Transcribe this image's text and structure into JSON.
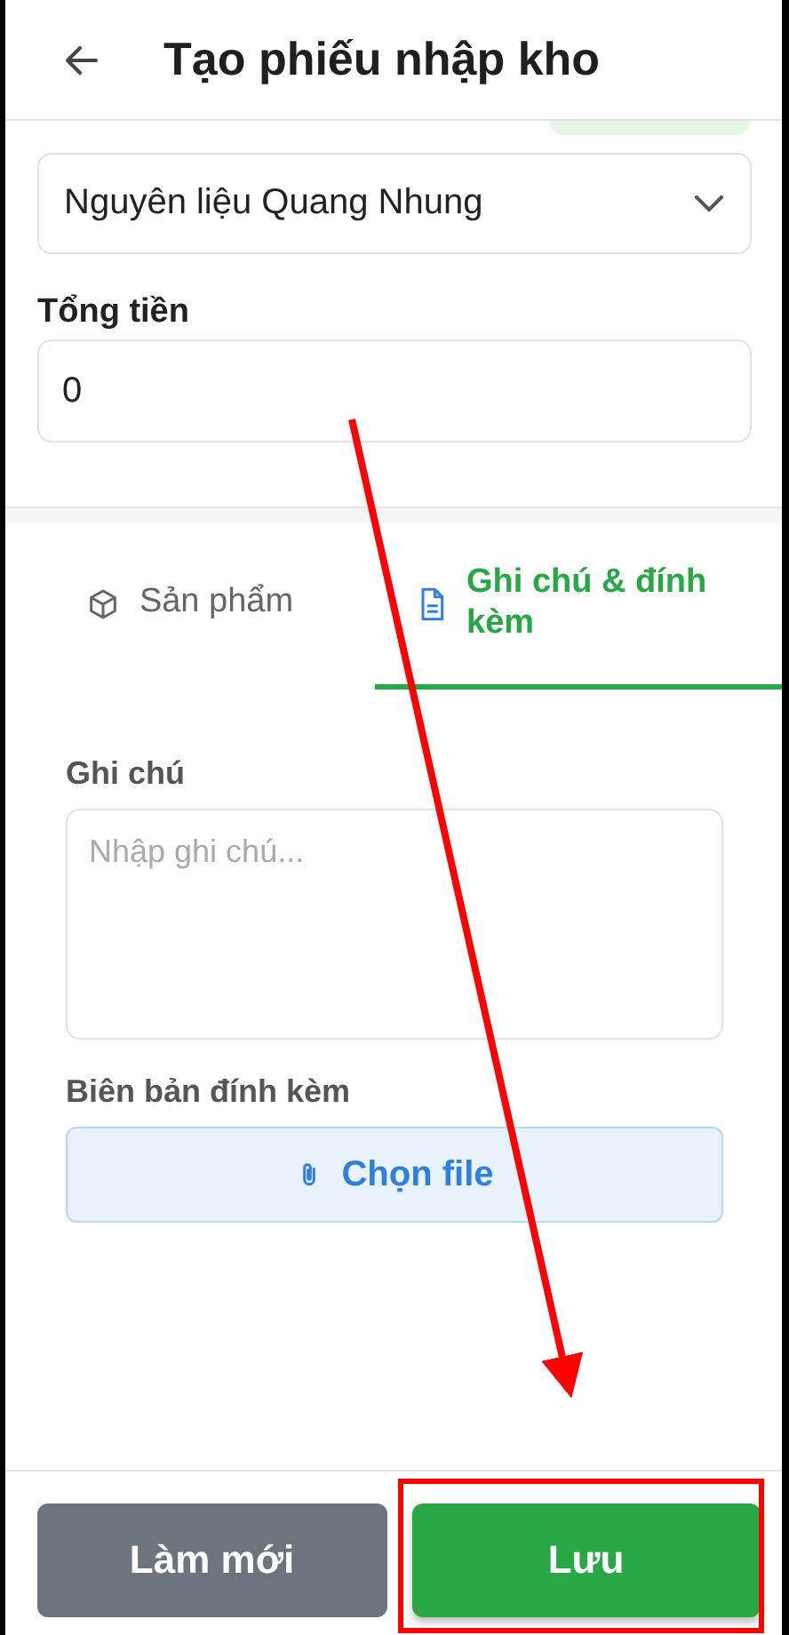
{
  "header": {
    "title": "Tạo phiếu nhập kho"
  },
  "supplier_select": {
    "value": "Nguyên liệu Quang Nhung"
  },
  "total": {
    "label": "Tổng tiền",
    "value": "0"
  },
  "tabs": [
    {
      "label": "Sản phẩm",
      "selected": false
    },
    {
      "label": "Ghi chú & đính kèm",
      "selected": true
    }
  ],
  "notes": {
    "label": "Ghi chú",
    "placeholder": "Nhập ghi chú..."
  },
  "attachment": {
    "label": "Biên bản đính kèm",
    "button": "Chọn file"
  },
  "footer_buttons": [
    {
      "label": "Làm mới",
      "kind": "secondary"
    },
    {
      "label": "Lưu",
      "kind": "primary"
    }
  ]
}
